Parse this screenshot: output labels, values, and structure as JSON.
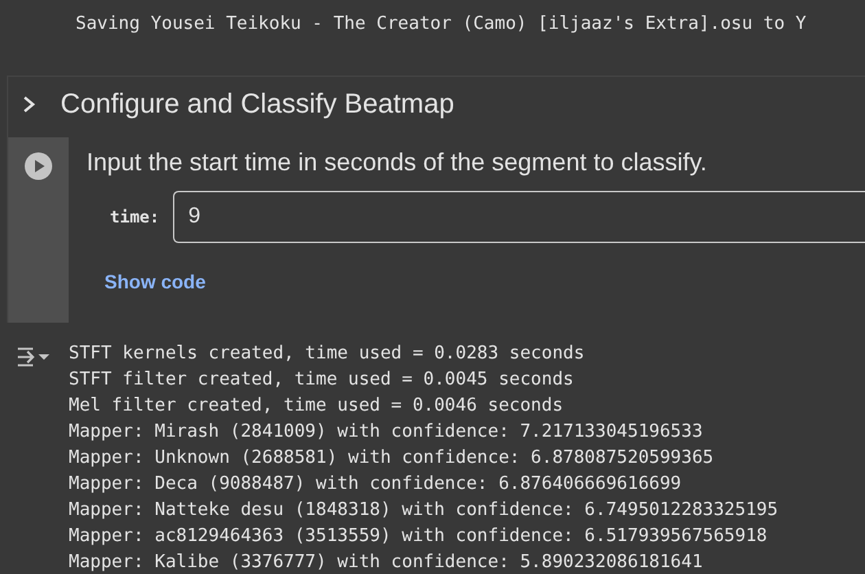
{
  "previous_output": [
    "Saving Yousei Teikoku - The Creator (Camo) [iljaaz's Extra].osu to Y"
  ],
  "section": {
    "title": "Configure and Classify Beatmap",
    "expanded": false
  },
  "cell": {
    "prompt": "Input the start time in seconds of the segment to classify.",
    "field": {
      "label": "time:",
      "value": "9"
    },
    "show_code": "Show code"
  },
  "output": [
    "STFT kernels created, time used = 0.0283 seconds",
    "STFT filter created, time used = 0.0045 seconds",
    "Mel filter created, time used = 0.0046 seconds",
    "Mapper: Mirash (2841009) with confidence: 7.217133045196533",
    "Mapper: Unknown (2688581) with confidence: 6.878087520599365",
    "Mapper: Deca (9088487) with confidence: 6.876406669616699",
    "Mapper: Natteke desu (1848318) with confidence: 6.7495012283325195",
    "Mapper: ac8129464363 (3513559) with confidence: 6.517939567565918",
    "Mapper: Kalibe (3376777) with confidence: 5.890232086181641"
  ]
}
